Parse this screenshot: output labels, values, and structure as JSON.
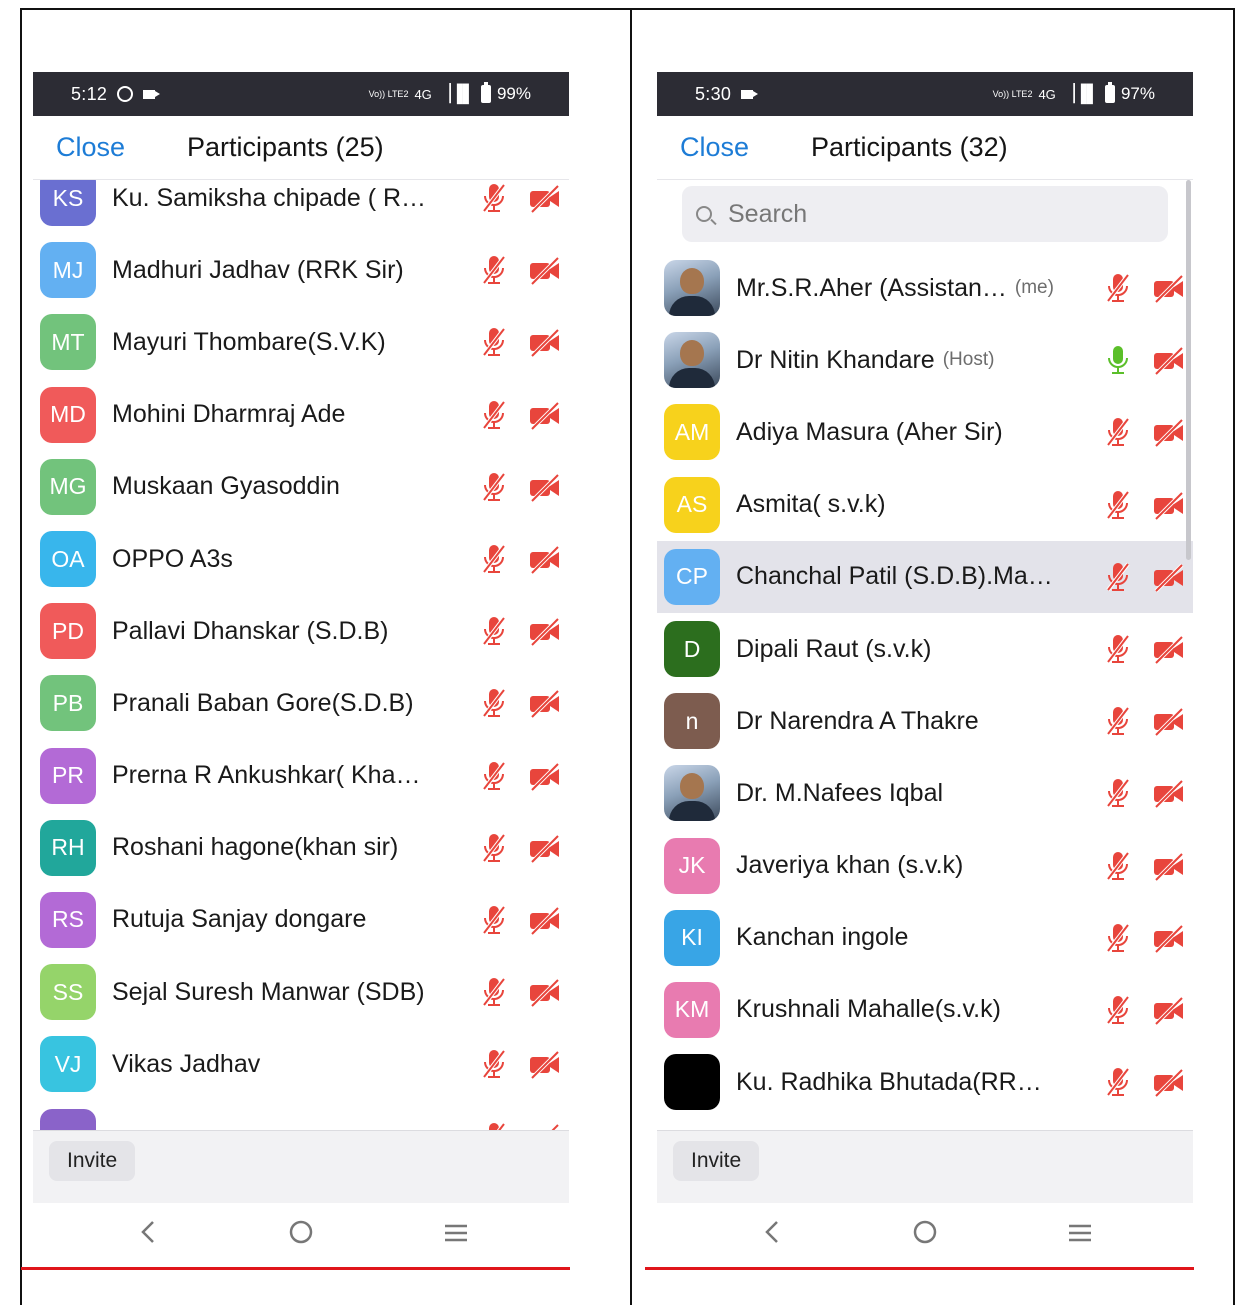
{
  "left": {
    "status": {
      "time": "5:12",
      "net_lte": "Vo)) LTE2",
      "net_4g": "4G",
      "battery": "99%"
    },
    "header": {
      "close_label": "Close",
      "title": "Participants (25)"
    },
    "participants": [
      {
        "initials": "KS",
        "name": "Ku. Samiksha chipade ( R…",
        "color": "#6a6fd1",
        "mic": "muted",
        "video": "off"
      },
      {
        "initials": "MJ",
        "name": "Madhuri Jadhav (RRK Sir)",
        "color": "#63b0f2",
        "mic": "muted",
        "video": "off"
      },
      {
        "initials": "MT",
        "name": "Mayuri Thombare(S.V.K)",
        "color": "#72c37c",
        "mic": "muted",
        "video": "off"
      },
      {
        "initials": "MD",
        "name": "Mohini Dharmraj Ade",
        "color": "#f05a5a",
        "mic": "muted",
        "video": "off"
      },
      {
        "initials": "MG",
        "name": "Muskaan Gyasoddin",
        "color": "#72c37c",
        "mic": "muted",
        "video": "off"
      },
      {
        "initials": "OA",
        "name": "OPPO A3s",
        "color": "#38b6ec",
        "mic": "muted",
        "video": "off"
      },
      {
        "initials": "PD",
        "name": "Pallavi Dhanskar (S.D.B)",
        "color": "#f05a5a",
        "mic": "muted",
        "video": "off"
      },
      {
        "initials": "PB",
        "name": "Pranali Baban Gore(S.D.B)",
        "color": "#72c37c",
        "mic": "muted",
        "video": "off"
      },
      {
        "initials": "PR",
        "name": "Prerna R Ankushkar( Kha…",
        "color": "#b36ad6",
        "mic": "muted",
        "video": "off"
      },
      {
        "initials": "RH",
        "name": "Roshani hagone(khan sir)",
        "color": "#21a79b",
        "mic": "muted",
        "video": "off"
      },
      {
        "initials": "RS",
        "name": "Rutuja Sanjay dongare",
        "color": "#b36ad6",
        "mic": "muted",
        "video": "off"
      },
      {
        "initials": "SS",
        "name": "Sejal Suresh Manwar (SDB)",
        "color": "#95d46a",
        "mic": "muted",
        "video": "off"
      },
      {
        "initials": "VJ",
        "name": "Vikas Jadhav",
        "color": "#38c4e0",
        "mic": "muted",
        "video": "off"
      },
      {
        "initials": "",
        "name": "",
        "color": "#8a63c9",
        "mic": "muted",
        "video": "off"
      }
    ],
    "invite_label": "Invite"
  },
  "right": {
    "status": {
      "time": "5:30",
      "net_lte": "Vo)) LTE2",
      "net_4g": "4G",
      "battery": "97%"
    },
    "header": {
      "close_label": "Close",
      "title": "Participants (32)"
    },
    "search": {
      "placeholder": "Search"
    },
    "participants": [
      {
        "initials": "",
        "photo": true,
        "name": "Mr.S.R.Aher (Assistan…",
        "tag": "(me)",
        "color": "#9aa7b8",
        "mic": "muted",
        "video": "off"
      },
      {
        "initials": "",
        "photo": true,
        "name": "Dr Nitin Khandare",
        "tag": "(Host)",
        "color": "#9aa7b8",
        "mic": "active",
        "video": "off"
      },
      {
        "initials": "AM",
        "name": "Adiya Masura (Aher Sir)",
        "color": "#f7d21c",
        "mic": "muted",
        "video": "off"
      },
      {
        "initials": "AS",
        "name": "Asmita( s.v.k)",
        "color": "#f7d21c",
        "mic": "muted",
        "video": "off"
      },
      {
        "initials": "CP",
        "name": "Chanchal Patil (S.D.B).Ma…",
        "color": "#63b0f2",
        "mic": "muted",
        "video": "off",
        "highlight": true
      },
      {
        "initials": "D",
        "name": "Dipali Raut (s.v.k)",
        "color": "#2c6e1e",
        "mic": "muted",
        "video": "off"
      },
      {
        "initials": "n",
        "name": "Dr Narendra A Thakre",
        "color": "#7d5c4f",
        "mic": "muted",
        "video": "off"
      },
      {
        "initials": "",
        "photo": true,
        "name": "Dr. M.Nafees Iqbal",
        "color": "#9aa7b8",
        "mic": "muted",
        "video": "off"
      },
      {
        "initials": "JK",
        "name": "Javeriya khan (s.v.k)",
        "color": "#e87bb0",
        "mic": "muted",
        "video": "off"
      },
      {
        "initials": "KI",
        "name": "Kanchan ingole",
        "color": "#38a5e6",
        "mic": "muted",
        "video": "off"
      },
      {
        "initials": "KM",
        "name": "Krushnali Mahalle(s.v.k)",
        "color": "#e87bb0",
        "mic": "muted",
        "video": "off"
      },
      {
        "initials": "",
        "name": "Ku. Radhika Bhutada(RR…",
        "color": "#000000",
        "mic": "muted",
        "video": "off"
      }
    ],
    "invite_label": "Invite"
  },
  "colors": {
    "accent": "#1d7cd6",
    "muted_icon": "#e8453c",
    "active_mic": "#5bbf2a",
    "status_bar": "#2c2c34"
  },
  "icons": {
    "mic_muted": "mic-muted-icon",
    "mic_active": "mic-icon",
    "video_off": "video-off-icon",
    "nav_back": "back-icon",
    "nav_home": "home-icon",
    "nav_recent": "recents-icon"
  }
}
